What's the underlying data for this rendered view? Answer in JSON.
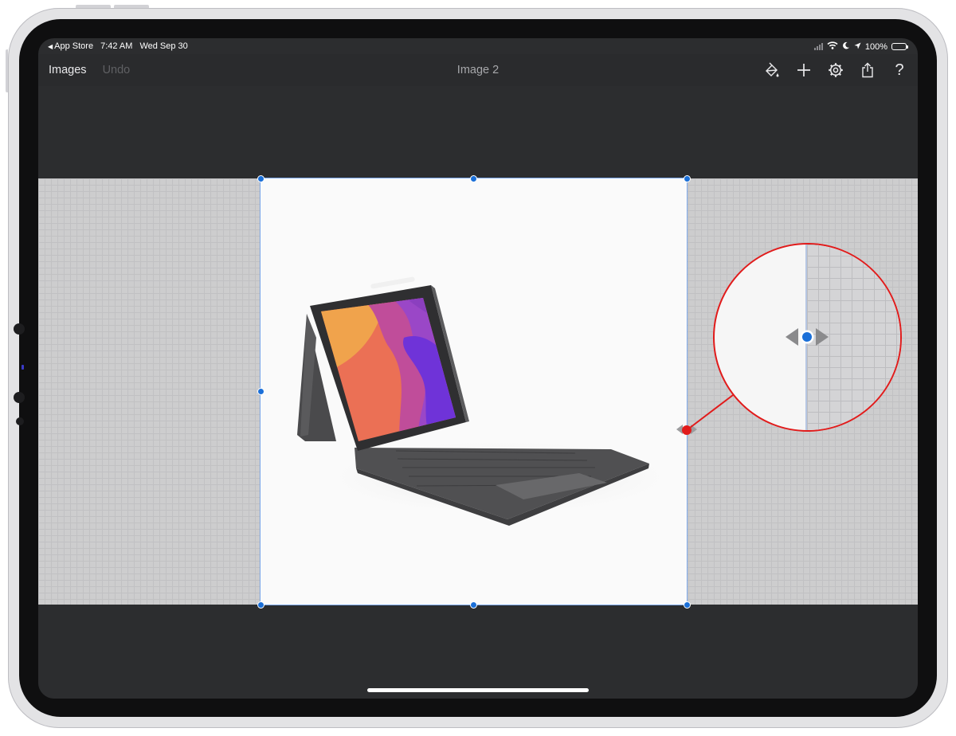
{
  "status_bar": {
    "back_app": "App Store",
    "time": "7:42 AM",
    "date": "Wed Sep 30",
    "battery": "100%"
  },
  "toolbar": {
    "images_label": "Images",
    "undo_label": "Undo",
    "title": "Image 2",
    "icons": [
      "paint-bucket-icon",
      "plus-icon",
      "gear-icon",
      "share-icon",
      "help-icon"
    ],
    "help_glyph": "?"
  },
  "colors": {
    "accent_handle": "#1a6fd8",
    "callout_red": "#e11b1b",
    "screen_bg": "#2c2d2f"
  }
}
